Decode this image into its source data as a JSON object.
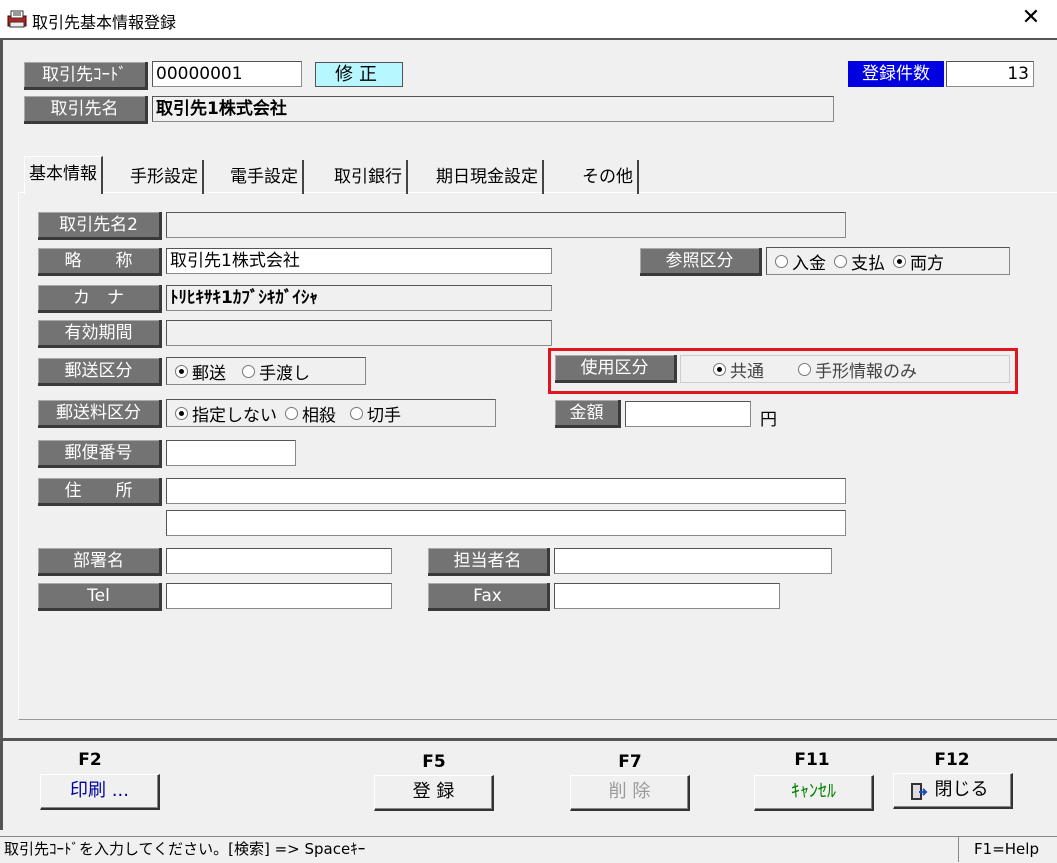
{
  "window": {
    "title": "取引先基本情報登録",
    "close": "✕"
  },
  "header": {
    "code_label": "取引先ｺｰﾄﾞ",
    "code_value": "00000001",
    "mode": "修正",
    "name_label": "取引先名",
    "name_value": "取引先1株式会社",
    "count_label": "登録件数",
    "count_value": "13"
  },
  "tabs": [
    "基本情報",
    "手形設定",
    "電手設定",
    "取引銀行",
    "期日現金設定",
    "その他"
  ],
  "form": {
    "name2_label": "取引先名2",
    "name2_value": "",
    "abbr_label": "略　　称",
    "abbr_value": "取引先1株式会社",
    "kana_label": "カ　ナ",
    "kana_value": "ﾄﾘﾋｷｻｷ1ｶﾌﾞｼｷｶﾞｲｼｬ",
    "valid_label": "有効期間",
    "valid_value": "",
    "ref_label": "参照区分",
    "ref_options": [
      "入金",
      "支払",
      "両方"
    ],
    "ref_selected": "両方",
    "mail_label": "郵送区分",
    "mail_options": [
      "郵送",
      "手渡し"
    ],
    "mail_selected": "郵送",
    "use_label": "使用区分",
    "use_options": [
      "共通",
      "手形情報のみ"
    ],
    "use_selected": "共通",
    "fee_label": "郵送料区分",
    "fee_options": [
      "指定しない",
      "相殺",
      "切手"
    ],
    "fee_selected": "指定しない",
    "amount_label": "金額",
    "amount_value": "",
    "amount_unit": "円",
    "zip_label": "郵便番号",
    "zip_value": "",
    "addr_label": "住　　所",
    "addr1_value": "",
    "addr2_value": "",
    "dept_label": "部署名",
    "dept_value": "",
    "contact_label": "担当者名",
    "contact_value": "",
    "tel_label": "Tel",
    "tel_value": "",
    "fax_label": "Fax",
    "fax_value": ""
  },
  "footer": {
    "f2": "F2",
    "f2_label": "印刷 ...",
    "f5": "F5",
    "f5_label": "登 録",
    "f7": "F7",
    "f7_label": "削 除",
    "f11": "F11",
    "f11_label": "ｷｬﾝｾﾙ",
    "f12": "F12",
    "f12_label": "閉じる"
  },
  "status": {
    "message": "取引先ｺｰﾄﾞを入力してください。[検索] => Spaceｷｰ",
    "help": "F1=Help"
  },
  "colors": {
    "highlight": "#e0161e",
    "cancel_green": "#008000",
    "f2_blue": "#0000a0",
    "count_label_bg": "#0000e0"
  }
}
